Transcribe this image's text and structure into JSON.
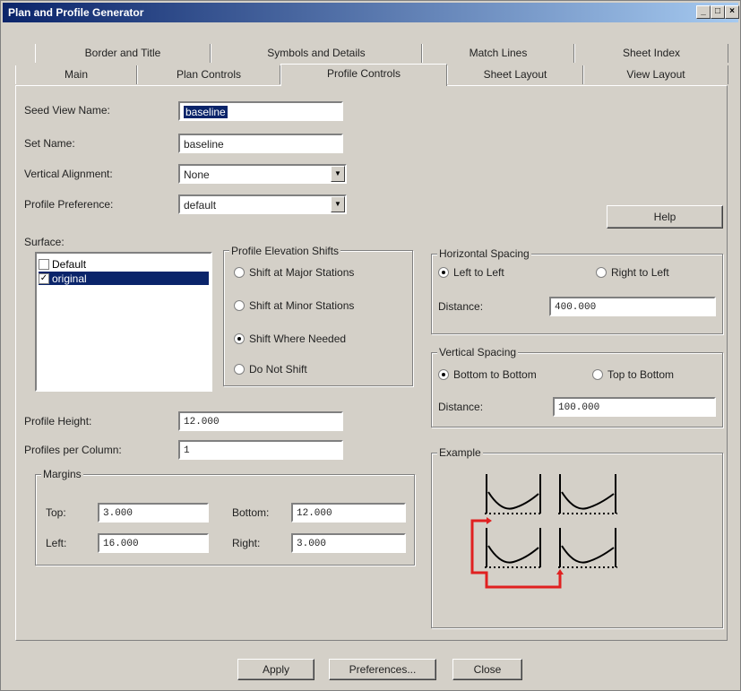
{
  "window": {
    "title": "Plan and Profile Generator"
  },
  "tabs_row1": [
    "Border and Title",
    "Symbols and Details",
    "Match Lines",
    "Sheet Index"
  ],
  "tabs_row2": [
    "Main",
    "Plan Controls",
    "Profile Controls",
    "Sheet Layout",
    "View Layout"
  ],
  "form": {
    "seed_view_name": {
      "label": "Seed View Name:",
      "value": "baseline"
    },
    "set_name": {
      "label": "Set Name:",
      "value": "baseline"
    },
    "vertical_alignment": {
      "label": "Vertical Alignment:",
      "value": "None"
    },
    "profile_preference": {
      "label": "Profile Preference:",
      "value": "default"
    },
    "help_label": "Help"
  },
  "surface": {
    "label": "Surface:",
    "items": [
      {
        "name": "Default",
        "checked": false,
        "selected": false
      },
      {
        "name": "original",
        "checked": true,
        "selected": true
      }
    ]
  },
  "elevation_shifts": {
    "title": "Profile Elevation Shifts",
    "options": [
      "Shift at Major Stations",
      "Shift at Minor Stations",
      "Shift Where Needed",
      "Do Not Shift"
    ],
    "selected": "Shift Where Needed"
  },
  "horizontal_spacing": {
    "title": "Horizontal Spacing",
    "left_option": "Left to Left",
    "right_option": "Right to Left",
    "selected": "Left to Left",
    "distance_label": "Distance:",
    "distance": "400.000"
  },
  "vertical_spacing": {
    "title": "Vertical Spacing",
    "left_option": "Bottom to Bottom",
    "right_option": "Top to Bottom",
    "selected": "Bottom to Bottom",
    "distance_label": "Distance:",
    "distance": "100.000"
  },
  "profile": {
    "height_label": "Profile Height:",
    "height": "12.000",
    "per_column_label": "Profiles per Column:",
    "per_column": "1"
  },
  "margins": {
    "title": "Margins",
    "top_label": "Top:",
    "top": "3.000",
    "bottom_label": "Bottom:",
    "bottom": "12.000",
    "left_label": "Left:",
    "left": "16.000",
    "right_label": "Right:",
    "right": "3.000"
  },
  "example": {
    "title": "Example",
    "path_color": "#e02020"
  },
  "footer": {
    "apply": "Apply",
    "preferences": "Preferences...",
    "close": "Close"
  },
  "colors": {
    "selection": "#0a246a",
    "face": "#d4d0c8"
  }
}
